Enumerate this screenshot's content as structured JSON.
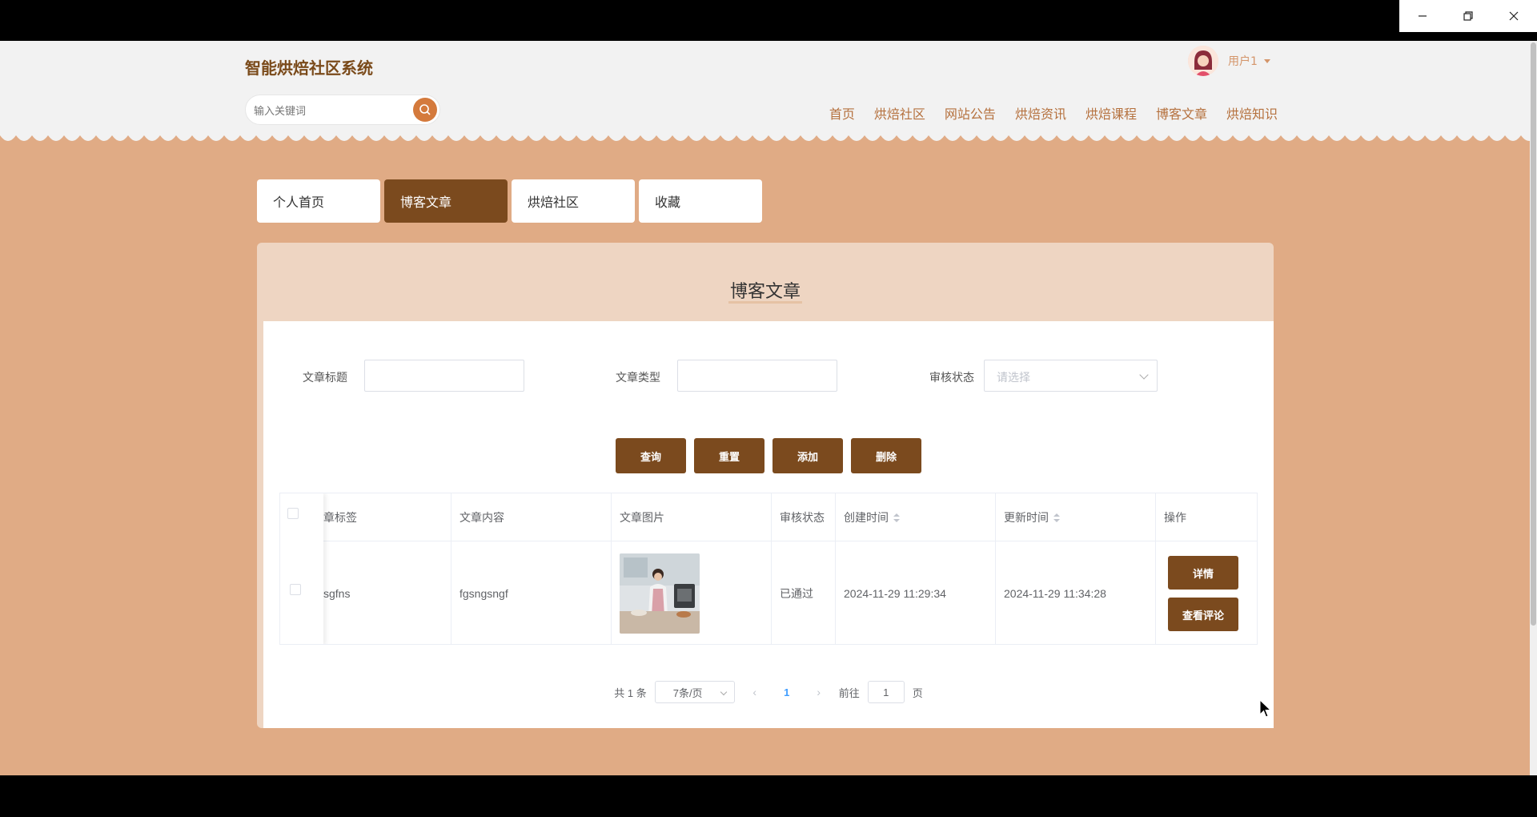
{
  "window": {
    "minimize_icon": "minimize-icon",
    "restore_icon": "restore-icon",
    "close_icon": "close-icon"
  },
  "header": {
    "site_title": "智能烘焙社区系统",
    "search_placeholder": "输入关键词",
    "nav": [
      "首页",
      "烘焙社区",
      "网站公告",
      "烘焙资讯",
      "烘焙课程",
      "博客文章",
      "烘焙知识"
    ],
    "user_name": "用户1"
  },
  "tabs": [
    {
      "label": "个人首页",
      "active": false
    },
    {
      "label": "博客文章",
      "active": true
    },
    {
      "label": "烘焙社区",
      "active": false
    },
    {
      "label": "收藏",
      "active": false
    }
  ],
  "panel": {
    "title": "博客文章",
    "filters": {
      "title_label": "文章标题",
      "type_label": "文章类型",
      "status_label": "审核状态",
      "status_placeholder": "请选择"
    },
    "buttons": {
      "query": "查询",
      "reset": "重置",
      "add": "添加",
      "delete": "删除"
    },
    "table": {
      "headers": [
        "章标签",
        "文章内容",
        "文章图片",
        "审核状态",
        "创建时间",
        "更新时间",
        "操作"
      ],
      "rows": [
        {
          "tag": "sgfns",
          "content": "fgsngsngf",
          "status": "已通过",
          "created": "2024-11-29 11:29:34",
          "updated": "2024-11-29 11:34:28",
          "detail_btn": "详情",
          "comment_btn": "查看评论"
        }
      ]
    },
    "pagination": {
      "total": "共 1 条",
      "page_size": "7条/页",
      "current": "1",
      "goto_prefix": "前往",
      "goto_value": "1",
      "goto_suffix": "页"
    }
  },
  "colors": {
    "brand": "#7b4a1e",
    "background": "#e0ab85",
    "accent": "#d47a3c"
  }
}
